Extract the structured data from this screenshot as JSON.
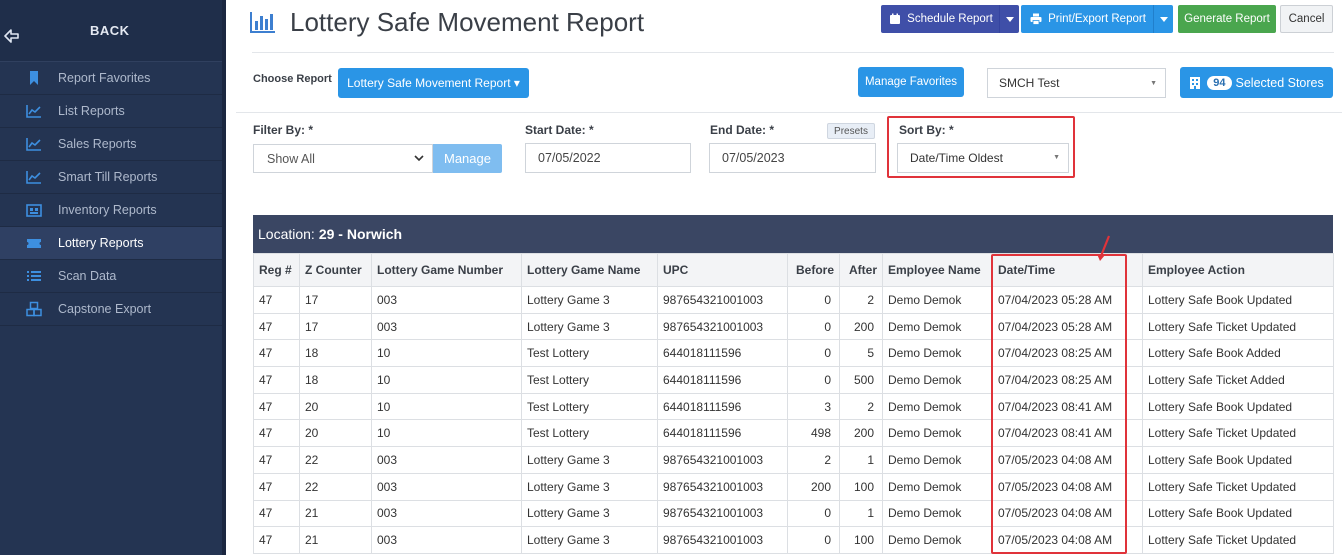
{
  "sidebar": {
    "back_label": "BACK",
    "items": [
      {
        "label": "Report Favorites",
        "icon": "bookmark-icon"
      },
      {
        "label": "List Reports",
        "icon": "line-chart-icon"
      },
      {
        "label": "Sales Reports",
        "icon": "line-chart-icon"
      },
      {
        "label": "Smart Till Reports",
        "icon": "line-chart-icon"
      },
      {
        "label": "Inventory Reports",
        "icon": "inventory-icon"
      },
      {
        "label": "Lottery Reports",
        "icon": "ticket-icon",
        "active": true
      },
      {
        "label": "Scan Data",
        "icon": "list-icon"
      },
      {
        "label": "Capstone Export",
        "icon": "cubes-icon"
      }
    ]
  },
  "header": {
    "title": "Lottery Safe Movement Report",
    "schedule_label": "Schedule Report",
    "print_label": "Print/Export Report",
    "generate_label": "Generate Report",
    "cancel_label": "Cancel"
  },
  "choose": {
    "label": "Choose Report",
    "report_button": "Lottery Safe Movement Report ▾",
    "favorites_label": "Manage Favorites",
    "store_value": "SMCH Test",
    "stores_count": "94",
    "stores_label": "Selected Stores"
  },
  "filters": {
    "filter_by_label": "Filter By: *",
    "filter_by_value": "Show All",
    "manage_label": "Manage",
    "start_label": "Start Date: *",
    "start_value": "07/05/2022",
    "end_label": "End Date: *",
    "end_value": "07/05/2023",
    "presets_label": "Presets",
    "sort_label": "Sort By: *",
    "sort_value": "Date/Time Oldest"
  },
  "location": {
    "prefix": "Location:",
    "name": "29 - Norwich"
  },
  "table": {
    "columns": [
      "Reg #",
      "Z Counter",
      "Lottery Game Number",
      "Lottery Game Name",
      "UPC",
      "Before",
      "After",
      "Employee Name",
      "Date/Time",
      "Employee Action"
    ],
    "rows": [
      [
        "47",
        "17",
        "003",
        "Lottery Game 3",
        "987654321001003",
        "0",
        "2",
        "Demo Demok",
        "07/04/2023 05:28 AM",
        "Lottery Safe Book Updated"
      ],
      [
        "47",
        "17",
        "003",
        "Lottery Game 3",
        "987654321001003",
        "0",
        "200",
        "Demo Demok",
        "07/04/2023 05:28 AM",
        "Lottery Safe Ticket Updated"
      ],
      [
        "47",
        "18",
        "10",
        "Test Lottery",
        "644018111596",
        "0",
        "5",
        "Demo Demok",
        "07/04/2023 08:25 AM",
        "Lottery Safe Book Added"
      ],
      [
        "47",
        "18",
        "10",
        "Test Lottery",
        "644018111596",
        "0",
        "500",
        "Demo Demok",
        "07/04/2023 08:25 AM",
        "Lottery Safe Ticket Added"
      ],
      [
        "47",
        "20",
        "10",
        "Test Lottery",
        "644018111596",
        "3",
        "2",
        "Demo Demok",
        "07/04/2023 08:41 AM",
        "Lottery Safe Book Updated"
      ],
      [
        "47",
        "20",
        "10",
        "Test Lottery",
        "644018111596",
        "498",
        "200",
        "Demo Demok",
        "07/04/2023 08:41 AM",
        "Lottery Safe Ticket Updated"
      ],
      [
        "47",
        "22",
        "003",
        "Lottery Game 3",
        "987654321001003",
        "2",
        "1",
        "Demo Demok",
        "07/05/2023 04:08 AM",
        "Lottery Safe Book Updated"
      ],
      [
        "47",
        "22",
        "003",
        "Lottery Game 3",
        "987654321001003",
        "200",
        "100",
        "Demo Demok",
        "07/05/2023 04:08 AM",
        "Lottery Safe Ticket Updated"
      ],
      [
        "47",
        "21",
        "003",
        "Lottery Game 3",
        "987654321001003",
        "0",
        "1",
        "Demo Demok",
        "07/05/2023 04:08 AM",
        "Lottery Safe Book Updated"
      ],
      [
        "47",
        "21",
        "003",
        "Lottery Game 3",
        "987654321001003",
        "0",
        "100",
        "Demo Demok",
        "07/05/2023 04:08 AM",
        "Lottery Safe Ticket Updated"
      ]
    ]
  },
  "colors": {
    "sidebar_bg": "#243452",
    "primary_blue": "#2a95e6",
    "indigo": "#3f4fa8",
    "green": "#4aa64e",
    "highlight_red": "#e0333a",
    "location_bar": "#3a4663"
  }
}
